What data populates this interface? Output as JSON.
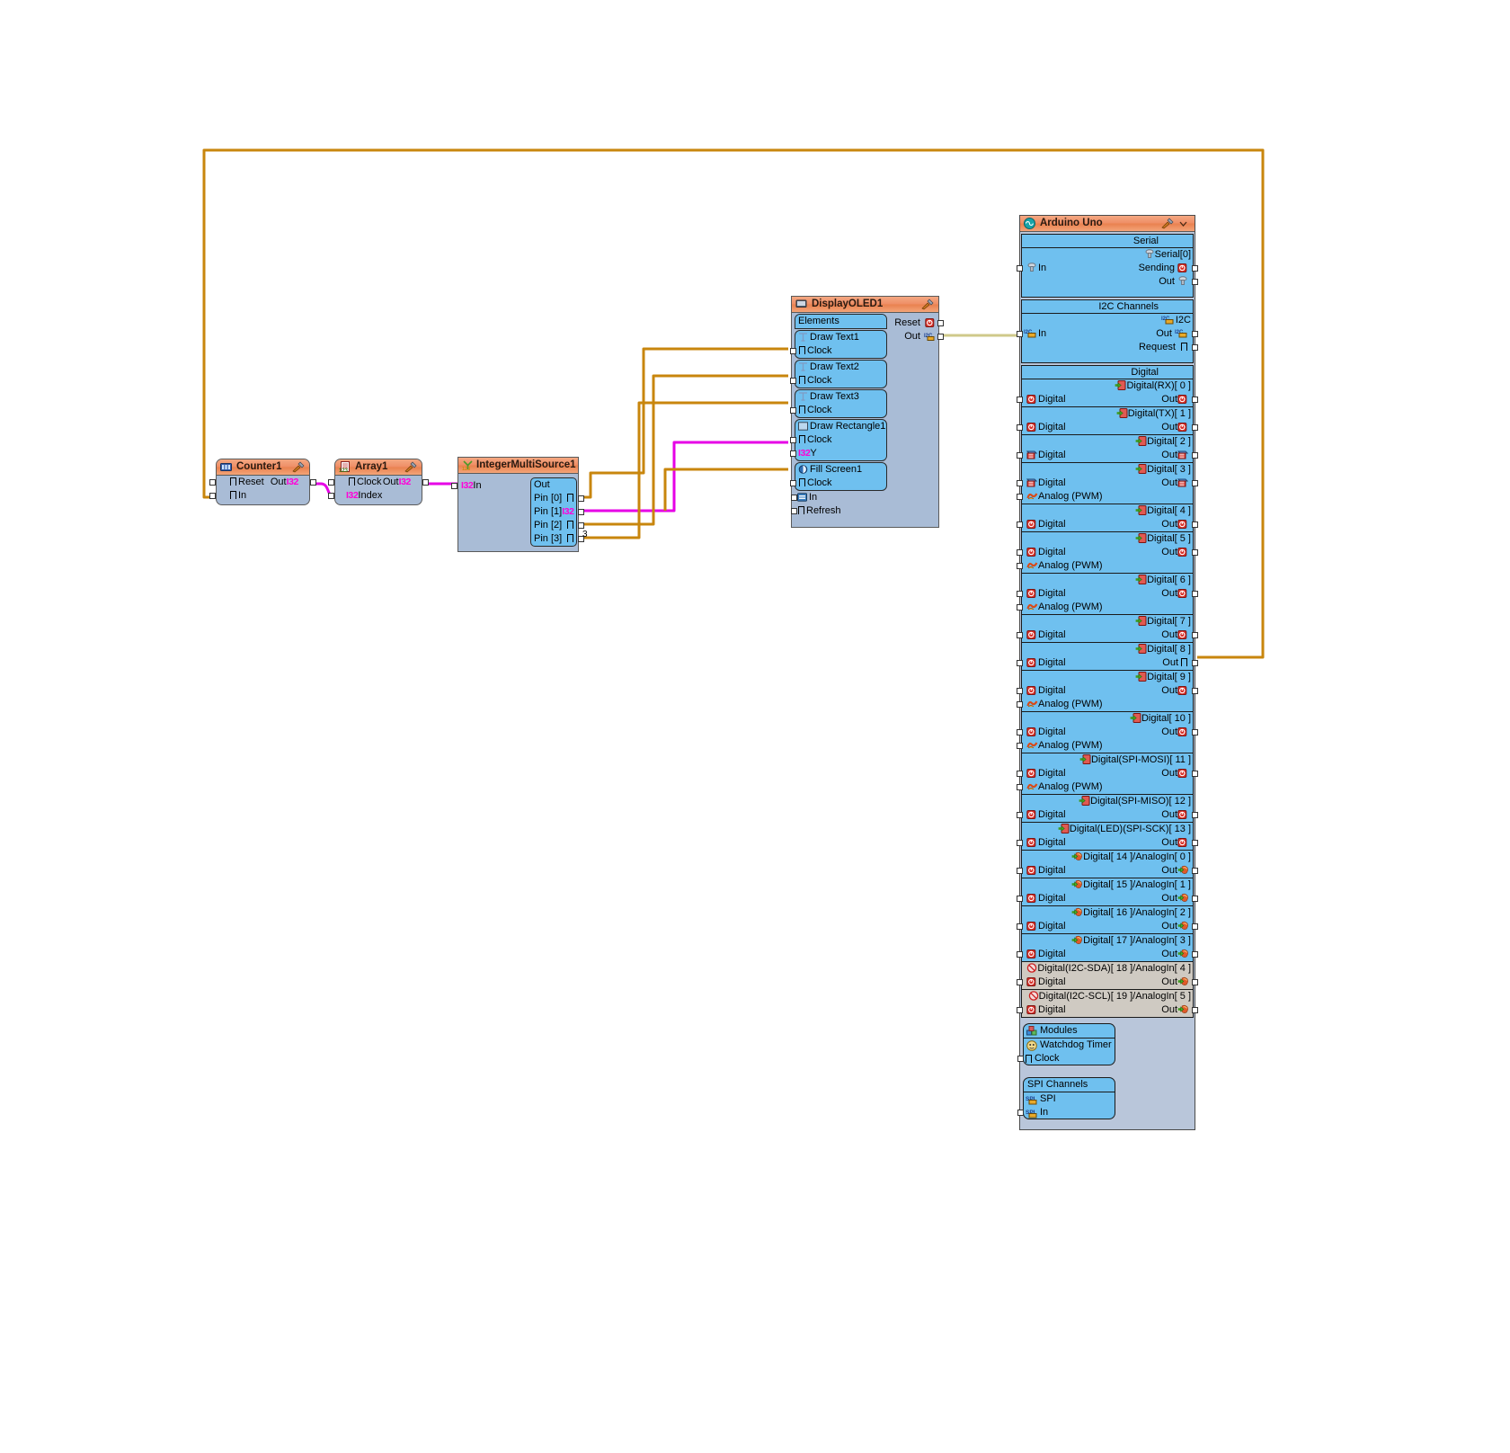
{
  "app": {
    "title": "Visuino Diagram Canvas",
    "background": "#ffffff"
  },
  "colors": {
    "wire_orange": "#c8860d",
    "wire_magenta": "#e600e6",
    "wire_olive": "#cfc98a",
    "component_body": "#a9bcd6",
    "component_title": "#ef8e66",
    "pin_group": "#6fc0ef",
    "type_tag": "#ff00d8",
    "disabled_row": "#cfcac2"
  },
  "components": {
    "counter": {
      "title": "Counter1",
      "icon": "counter-icon",
      "tools_icon": "tools-icon",
      "pins_left": [
        {
          "label": "Reset",
          "glyph": "clock"
        },
        {
          "label": "In",
          "glyph": "clock"
        }
      ],
      "pins_right": [
        {
          "label": "Out",
          "type": "I32"
        }
      ]
    },
    "array": {
      "title": "Array1",
      "icon": "array-icon",
      "tools_icon": "tools-icon",
      "pins_left": [
        {
          "label": "Clock",
          "glyph": "clock"
        },
        {
          "label": "Index",
          "type": "I32"
        }
      ],
      "pins_right": [
        {
          "label": "Out",
          "type": "I32"
        }
      ]
    },
    "integer_multi_source": {
      "title": "IntegerMultiSource1",
      "icon": "multisource-icon",
      "pins_left": [
        {
          "label": "In",
          "type": "I32"
        }
      ],
      "out_group": {
        "header": "Out",
        "rows": [
          {
            "label": "Pin [0]",
            "glyph": "clock"
          },
          {
            "label": "Pin [1]",
            "type": "I32"
          },
          {
            "label": "Pin [2]",
            "glyph": "clock"
          },
          {
            "label": "Pin [3]",
            "glyph": "clock"
          }
        ]
      },
      "annotation": "3"
    },
    "display_oled": {
      "title": "DisplayOLED1",
      "icon": "display-icon",
      "tools_icon": "tools-icon",
      "elements_header": "Elements",
      "elements": [
        {
          "name": "Draw Text1",
          "icon": "text-icon",
          "pins": [
            {
              "label": "Clock",
              "glyph": "clock"
            }
          ]
        },
        {
          "name": "Draw Text2",
          "icon": "text-icon",
          "pins": [
            {
              "label": "Clock",
              "glyph": "clock"
            }
          ]
        },
        {
          "name": "Draw Text3",
          "icon": "text-icon",
          "pins": [
            {
              "label": "Clock",
              "glyph": "clock"
            }
          ]
        },
        {
          "name": "Draw Rectangle1",
          "icon": "rectangle-icon",
          "pins": [
            {
              "label": "Clock",
              "glyph": "clock"
            },
            {
              "label": "Y",
              "type": "I32"
            }
          ]
        },
        {
          "name": "Fill Screen1",
          "icon": "fill-icon",
          "pins": [
            {
              "label": "Clock",
              "glyph": "clock"
            }
          ]
        }
      ],
      "bottom_pins": [
        {
          "label": "In",
          "icon": "display-in-icon"
        },
        {
          "label": "Refresh",
          "glyph": "clock"
        }
      ],
      "pins_right": [
        {
          "label": "Reset",
          "icon": "reset-icon"
        },
        {
          "label": "Out",
          "icon": "i2c-icon"
        }
      ]
    },
    "arduino": {
      "title": "Arduino Uno",
      "icon": "arduino-icon",
      "tools_icon": "tools-icon",
      "dropdown_icon": "chevron-down-icon",
      "sections": [
        {
          "header": "Serial",
          "groups": [
            {
              "caption": "Serial[0]",
              "caption_icon": "serial-icon",
              "left": [
                {
                  "label": "In",
                  "icon": "serial-icon"
                }
              ],
              "right": [
                {
                  "label": "Sending",
                  "icon": "digital-red-icon"
                },
                {
                  "label": "Out",
                  "icon": "serial-out-icon"
                }
              ]
            }
          ]
        },
        {
          "header": "I2C Channels",
          "groups": [
            {
              "caption": "I2C",
              "caption_icon": "i2c-icon",
              "left": [
                {
                  "label": "In",
                  "icon": "i2c-icon"
                }
              ],
              "right": [
                {
                  "label": "Out",
                  "icon": "i2c-icon"
                },
                {
                  "label": "Request",
                  "glyph": "clock"
                }
              ]
            }
          ]
        },
        {
          "header": "Digital",
          "groups": [
            {
              "caption": "Digital(RX)[ 0 ]",
              "caption_icon": "digital-green-icon",
              "left": [
                {
                  "label": "Digital",
                  "icon": "digital-red-icon"
                }
              ],
              "right": [
                {
                  "label": "Out",
                  "icon": "digital-red-icon"
                }
              ]
            },
            {
              "caption": "Digital(TX)[ 1 ]",
              "caption_icon": "digital-green-icon",
              "left": [
                {
                  "label": "Digital",
                  "icon": "digital-red-icon"
                }
              ],
              "right": [
                {
                  "label": "Out",
                  "icon": "digital-red-icon"
                }
              ]
            },
            {
              "caption": "Digital[ 2 ]",
              "caption_icon": "digital-green-icon",
              "left": [
                {
                  "label": "Digital",
                  "icon": "digital-blue-icon"
                }
              ],
              "right": [
                {
                  "label": "Out",
                  "icon": "digital-blue-icon"
                }
              ]
            },
            {
              "caption": "Digital[ 3 ]",
              "caption_icon": "digital-green-icon",
              "left": [
                {
                  "label": "Digital",
                  "icon": "digital-blue-icon"
                },
                {
                  "label": "Analog (PWM)",
                  "icon": "pwm-icon"
                }
              ],
              "right": [
                {
                  "label": "Out",
                  "icon": "digital-blue-icon"
                }
              ]
            },
            {
              "caption": "Digital[ 4 ]",
              "caption_icon": "digital-green-icon",
              "left": [
                {
                  "label": "Digital",
                  "icon": "digital-red-icon"
                }
              ],
              "right": [
                {
                  "label": "Out",
                  "icon": "digital-red-icon"
                }
              ]
            },
            {
              "caption": "Digital[ 5 ]",
              "caption_icon": "digital-green-icon",
              "left": [
                {
                  "label": "Digital",
                  "icon": "digital-red-icon"
                },
                {
                  "label": "Analog (PWM)",
                  "icon": "pwm-icon"
                }
              ],
              "right": [
                {
                  "label": "Out",
                  "icon": "digital-red-icon"
                }
              ]
            },
            {
              "caption": "Digital[ 6 ]",
              "caption_icon": "digital-green-icon",
              "left": [
                {
                  "label": "Digital",
                  "icon": "digital-red-icon"
                },
                {
                  "label": "Analog (PWM)",
                  "icon": "pwm-icon"
                }
              ],
              "right": [
                {
                  "label": "Out",
                  "icon": "digital-red-icon"
                }
              ]
            },
            {
              "caption": "Digital[ 7 ]",
              "caption_icon": "digital-green-icon",
              "left": [
                {
                  "label": "Digital",
                  "icon": "digital-red-icon"
                }
              ],
              "right": [
                {
                  "label": "Out",
                  "icon": "digital-red-icon"
                }
              ]
            },
            {
              "caption": "Digital[ 8 ]",
              "caption_icon": "digital-green-icon",
              "left": [
                {
                  "label": "Digital",
                  "icon": "digital-red-icon"
                }
              ],
              "right": [
                {
                  "label": "Out",
                  "glyph": "clock"
                }
              ]
            },
            {
              "caption": "Digital[ 9 ]",
              "caption_icon": "digital-green-icon",
              "left": [
                {
                  "label": "Digital",
                  "icon": "digital-red-icon"
                },
                {
                  "label": "Analog (PWM)",
                  "icon": "pwm-icon"
                }
              ],
              "right": [
                {
                  "label": "Out",
                  "icon": "digital-red-icon"
                }
              ]
            },
            {
              "caption": "Digital[ 10 ]",
              "caption_icon": "digital-green-icon",
              "left": [
                {
                  "label": "Digital",
                  "icon": "digital-red-icon"
                },
                {
                  "label": "Analog (PWM)",
                  "icon": "pwm-icon"
                }
              ],
              "right": [
                {
                  "label": "Out",
                  "icon": "digital-red-icon"
                }
              ]
            },
            {
              "caption": "Digital(SPI-MOSI)[ 11 ]",
              "caption_icon": "digital-green-icon",
              "left": [
                {
                  "label": "Digital",
                  "icon": "digital-red-icon"
                },
                {
                  "label": "Analog (PWM)",
                  "icon": "pwm-icon"
                }
              ],
              "right": [
                {
                  "label": "Out",
                  "icon": "digital-red-icon"
                }
              ]
            },
            {
              "caption": "Digital(SPI-MISO)[ 12 ]",
              "caption_icon": "digital-green-icon",
              "left": [
                {
                  "label": "Digital",
                  "icon": "digital-red-icon"
                }
              ],
              "right": [
                {
                  "label": "Out",
                  "icon": "digital-red-icon"
                }
              ]
            },
            {
              "caption": "Digital(LED)(SPI-SCK)[ 13 ]",
              "caption_icon": "digital-green-icon",
              "left": [
                {
                  "label": "Digital",
                  "icon": "digital-red-icon"
                }
              ],
              "right": [
                {
                  "label": "Out",
                  "icon": "digital-red-icon"
                }
              ]
            },
            {
              "caption": "Digital[ 14 ]/AnalogIn[ 0 ]",
              "caption_icon": "analog-icon",
              "left": [
                {
                  "label": "Digital",
                  "icon": "digital-red-icon"
                }
              ],
              "right": [
                {
                  "label": "Out",
                  "icon": "analog-icon"
                }
              ]
            },
            {
              "caption": "Digital[ 15 ]/AnalogIn[ 1 ]",
              "caption_icon": "analog-icon",
              "left": [
                {
                  "label": "Digital",
                  "icon": "digital-red-icon"
                }
              ],
              "right": [
                {
                  "label": "Out",
                  "icon": "analog-icon"
                }
              ]
            },
            {
              "caption": "Digital[ 16 ]/AnalogIn[ 2 ]",
              "caption_icon": "analog-icon",
              "left": [
                {
                  "label": "Digital",
                  "icon": "digital-red-icon"
                }
              ],
              "right": [
                {
                  "label": "Out",
                  "icon": "analog-icon"
                }
              ]
            },
            {
              "caption": "Digital[ 17 ]/AnalogIn[ 3 ]",
              "caption_icon": "analog-icon",
              "left": [
                {
                  "label": "Digital",
                  "icon": "digital-red-icon"
                }
              ],
              "right": [
                {
                  "label": "Out",
                  "icon": "analog-icon"
                }
              ]
            },
            {
              "caption": "Digital(I2C-SDA)[ 18 ]/AnalogIn[ 4 ]",
              "caption_icon": "blocked-icon",
              "disabled": true,
              "left": [
                {
                  "label": "Digital",
                  "icon": "digital-red-icon"
                }
              ],
              "right": [
                {
                  "label": "Out",
                  "icon": "analog-icon"
                }
              ]
            },
            {
              "caption": "Digital(I2C-SCL)[ 19 ]/AnalogIn[ 5 ]",
              "caption_icon": "blocked-icon",
              "disabled": true,
              "left": [
                {
                  "label": "Digital",
                  "icon": "digital-red-icon"
                }
              ],
              "right": [
                {
                  "label": "Out",
                  "icon": "analog-icon"
                }
              ]
            }
          ]
        }
      ],
      "modules": {
        "header": "Modules",
        "header_icon": "modules-icon",
        "items": [
          {
            "label": "Watchdog Timer",
            "icon": "watchdog-icon"
          },
          {
            "label": "Clock",
            "glyph": "clock"
          }
        ]
      },
      "spi": {
        "header": "SPI Channels",
        "items": [
          {
            "label": "SPI",
            "icon": "spi-icon"
          },
          {
            "label": "In",
            "icon": "spi-icon"
          }
        ]
      }
    }
  },
  "wires": [
    {
      "name": "counter-in-from-digital8",
      "color": "#c8860d",
      "from": "arduino.Digital[8].Out",
      "to": "counter.In"
    },
    {
      "name": "counter-out-to-array-clock",
      "color": "#e600e6",
      "from": "counter.Out",
      "to": "array.Clock"
    },
    {
      "name": "array-out-to-ims-in",
      "color": "#e600e6",
      "from": "array.Out",
      "to": "integer_multi_source.In"
    },
    {
      "name": "ims-pin0-to-drawtext1-clock",
      "color": "#c8860d",
      "from": "integer_multi_source.Pin[0]",
      "to": "display_oled.DrawText1.Clock"
    },
    {
      "name": "ims-pin1-to-drawrect1-y",
      "color": "#e600e6",
      "from": "integer_multi_source.Pin[1]",
      "to": "display_oled.DrawRectangle1.Y"
    },
    {
      "name": "ims-pin2-to-drawtext2-clock",
      "color": "#c8860d",
      "from": "integer_multi_source.Pin[2]",
      "to": "display_oled.DrawText2.Clock"
    },
    {
      "name": "ims-pin3-to-drawtext3-clock",
      "color": "#c8860d",
      "from": "integer_multi_source.Pin[3]",
      "to": "display_oled.DrawText3.Clock"
    },
    {
      "name": "oled-out-to-arduino-i2c-in",
      "color": "#cfc98a",
      "from": "display_oled.Out",
      "to": "arduino.I2C.In"
    }
  ]
}
